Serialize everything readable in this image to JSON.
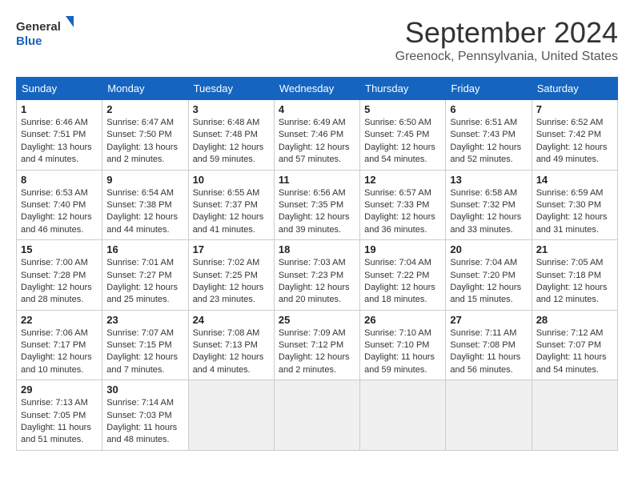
{
  "header": {
    "logo_line1": "General",
    "logo_line2": "Blue",
    "month": "September 2024",
    "location": "Greenock, Pennsylvania, United States"
  },
  "days_of_week": [
    "Sunday",
    "Monday",
    "Tuesday",
    "Wednesday",
    "Thursday",
    "Friday",
    "Saturday"
  ],
  "weeks": [
    [
      {
        "day": 1,
        "sunrise": "6:46 AM",
        "sunset": "7:51 PM",
        "daylight": "13 hours and 4 minutes."
      },
      {
        "day": 2,
        "sunrise": "6:47 AM",
        "sunset": "7:50 PM",
        "daylight": "13 hours and 2 minutes."
      },
      {
        "day": 3,
        "sunrise": "6:48 AM",
        "sunset": "7:48 PM",
        "daylight": "12 hours and 59 minutes."
      },
      {
        "day": 4,
        "sunrise": "6:49 AM",
        "sunset": "7:46 PM",
        "daylight": "12 hours and 57 minutes."
      },
      {
        "day": 5,
        "sunrise": "6:50 AM",
        "sunset": "7:45 PM",
        "daylight": "12 hours and 54 minutes."
      },
      {
        "day": 6,
        "sunrise": "6:51 AM",
        "sunset": "7:43 PM",
        "daylight": "12 hours and 52 minutes."
      },
      {
        "day": 7,
        "sunrise": "6:52 AM",
        "sunset": "7:42 PM",
        "daylight": "12 hours and 49 minutes."
      }
    ],
    [
      {
        "day": 8,
        "sunrise": "6:53 AM",
        "sunset": "7:40 PM",
        "daylight": "12 hours and 46 minutes."
      },
      {
        "day": 9,
        "sunrise": "6:54 AM",
        "sunset": "7:38 PM",
        "daylight": "12 hours and 44 minutes."
      },
      {
        "day": 10,
        "sunrise": "6:55 AM",
        "sunset": "7:37 PM",
        "daylight": "12 hours and 41 minutes."
      },
      {
        "day": 11,
        "sunrise": "6:56 AM",
        "sunset": "7:35 PM",
        "daylight": "12 hours and 39 minutes."
      },
      {
        "day": 12,
        "sunrise": "6:57 AM",
        "sunset": "7:33 PM",
        "daylight": "12 hours and 36 minutes."
      },
      {
        "day": 13,
        "sunrise": "6:58 AM",
        "sunset": "7:32 PM",
        "daylight": "12 hours and 33 minutes."
      },
      {
        "day": 14,
        "sunrise": "6:59 AM",
        "sunset": "7:30 PM",
        "daylight": "12 hours and 31 minutes."
      }
    ],
    [
      {
        "day": 15,
        "sunrise": "7:00 AM",
        "sunset": "7:28 PM",
        "daylight": "12 hours and 28 minutes."
      },
      {
        "day": 16,
        "sunrise": "7:01 AM",
        "sunset": "7:27 PM",
        "daylight": "12 hours and 25 minutes."
      },
      {
        "day": 17,
        "sunrise": "7:02 AM",
        "sunset": "7:25 PM",
        "daylight": "12 hours and 23 minutes."
      },
      {
        "day": 18,
        "sunrise": "7:03 AM",
        "sunset": "7:23 PM",
        "daylight": "12 hours and 20 minutes."
      },
      {
        "day": 19,
        "sunrise": "7:04 AM",
        "sunset": "7:22 PM",
        "daylight": "12 hours and 18 minutes."
      },
      {
        "day": 20,
        "sunrise": "7:04 AM",
        "sunset": "7:20 PM",
        "daylight": "12 hours and 15 minutes."
      },
      {
        "day": 21,
        "sunrise": "7:05 AM",
        "sunset": "7:18 PM",
        "daylight": "12 hours and 12 minutes."
      }
    ],
    [
      {
        "day": 22,
        "sunrise": "7:06 AM",
        "sunset": "7:17 PM",
        "daylight": "12 hours and 10 minutes."
      },
      {
        "day": 23,
        "sunrise": "7:07 AM",
        "sunset": "7:15 PM",
        "daylight": "12 hours and 7 minutes."
      },
      {
        "day": 24,
        "sunrise": "7:08 AM",
        "sunset": "7:13 PM",
        "daylight": "12 hours and 4 minutes."
      },
      {
        "day": 25,
        "sunrise": "7:09 AM",
        "sunset": "7:12 PM",
        "daylight": "12 hours and 2 minutes."
      },
      {
        "day": 26,
        "sunrise": "7:10 AM",
        "sunset": "7:10 PM",
        "daylight": "11 hours and 59 minutes."
      },
      {
        "day": 27,
        "sunrise": "7:11 AM",
        "sunset": "7:08 PM",
        "daylight": "11 hours and 56 minutes."
      },
      {
        "day": 28,
        "sunrise": "7:12 AM",
        "sunset": "7:07 PM",
        "daylight": "11 hours and 54 minutes."
      }
    ],
    [
      {
        "day": 29,
        "sunrise": "7:13 AM",
        "sunset": "7:05 PM",
        "daylight": "11 hours and 51 minutes."
      },
      {
        "day": 30,
        "sunrise": "7:14 AM",
        "sunset": "7:03 PM",
        "daylight": "11 hours and 48 minutes."
      },
      null,
      null,
      null,
      null,
      null
    ]
  ]
}
